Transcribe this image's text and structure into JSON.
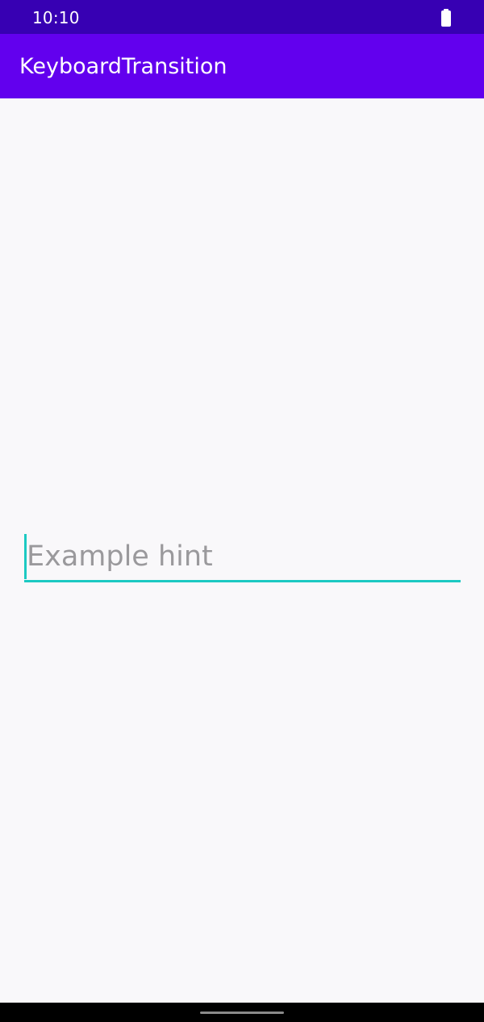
{
  "status_bar": {
    "time": "10:10",
    "battery_icon": "battery-full-icon",
    "background_color": "#3700b3"
  },
  "app_bar": {
    "title": "KeyboardTransition",
    "background_color": "#6200ee"
  },
  "edit_text": {
    "value": "",
    "placeholder": "Example hint",
    "accent_color": "#1cc9c2"
  },
  "nav_bar": {
    "handle_icon": "home-gesture-handle"
  }
}
